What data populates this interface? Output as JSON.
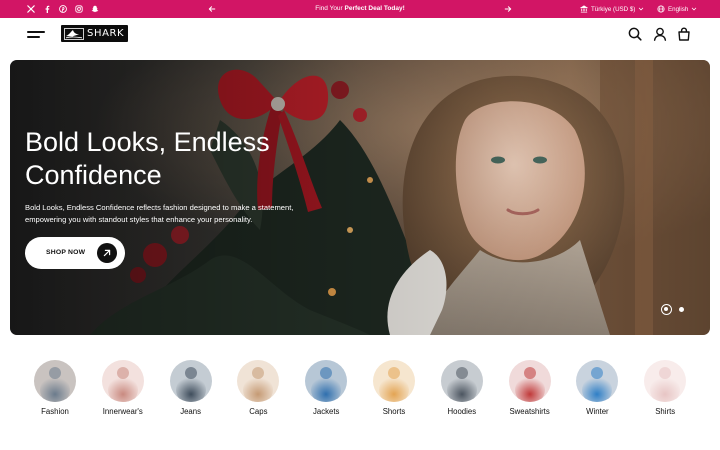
{
  "announcement": {
    "prefix": "Find Your ",
    "highlight": "Perfect Deal Today!",
    "background": "#d21565",
    "currency": "Türkiye (USD $)",
    "language": "English"
  },
  "social_icons": [
    "x-icon",
    "facebook-icon",
    "pinterest-icon",
    "instagram-icon",
    "snapchat-icon"
  ],
  "header": {
    "logo_text": "SHARK",
    "icons": [
      "search-icon",
      "account-icon",
      "cart-icon"
    ]
  },
  "hero": {
    "title": "Bold Looks, Endless Confidence",
    "description": "Bold Looks, Endless Confidence reflects fashion designed to make a statement, empowering you with standout styles that enhance your personality.",
    "button": "SHOP NOW",
    "slides_total": 2,
    "active_slide": 1
  },
  "categories": [
    {
      "label": "Fashion",
      "colors": [
        "#c9c3c0",
        "#6b7b8c"
      ]
    },
    {
      "label": "Innerwear's",
      "colors": [
        "#f3e1de",
        "#c98a80"
      ]
    },
    {
      "label": "Jeans",
      "colors": [
        "#c4ccd3",
        "#3f4d5c"
      ]
    },
    {
      "label": "Caps",
      "colors": [
        "#f0e3d6",
        "#c59a74"
      ]
    },
    {
      "label": "Jackets",
      "colors": [
        "#b7c7d6",
        "#2f6fae"
      ]
    },
    {
      "label": "Shorts",
      "colors": [
        "#f6e6cf",
        "#e3a453"
      ]
    },
    {
      "label": "Hoodies",
      "colors": [
        "#c7ccd1",
        "#4c5560"
      ]
    },
    {
      "label": "Sweatshirts",
      "colors": [
        "#f0dada",
        "#c03a3a"
      ]
    },
    {
      "label": "Winter",
      "colors": [
        "#c9d3de",
        "#2f7fc6"
      ]
    },
    {
      "label": "Shirts",
      "colors": [
        "#f8eceb",
        "#e7c5c4"
      ]
    }
  ]
}
